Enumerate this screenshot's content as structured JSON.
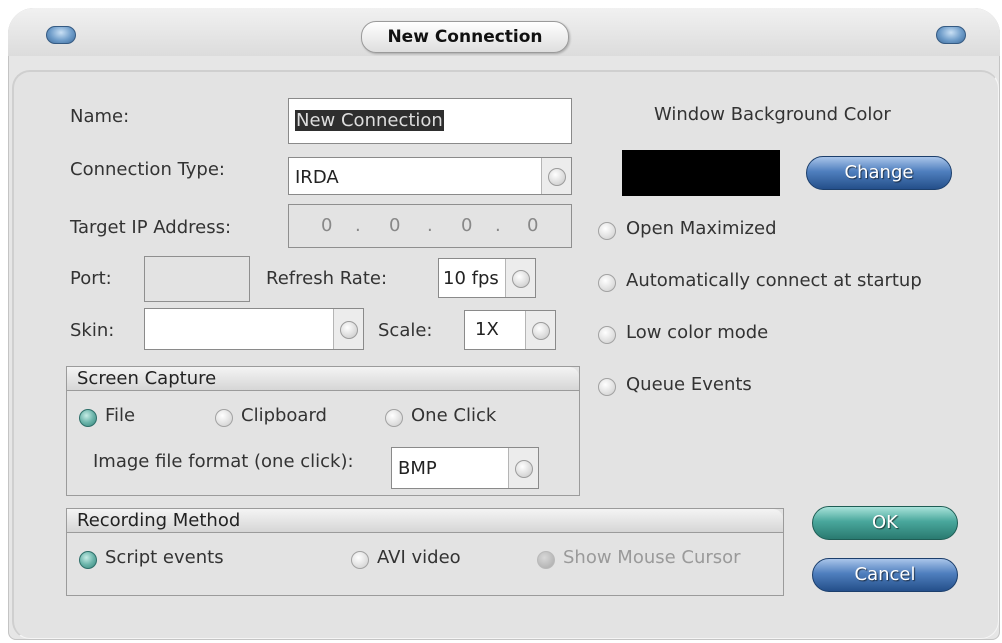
{
  "window": {
    "title": "New Connection"
  },
  "form": {
    "name_label": "Name:",
    "name_value": "New Connection",
    "connection_type_label": "Connection Type:",
    "connection_type_value": "IRDA",
    "target_ip_label": "Target IP Address:",
    "ip_octets": [
      "0",
      "0",
      "0",
      "0"
    ],
    "port_label": "Port:",
    "port_value": "",
    "refresh_rate_label": "Refresh Rate:",
    "refresh_rate_value": "10 fps",
    "skin_label": "Skin:",
    "skin_value": "",
    "scale_label": "Scale:",
    "scale_value": "1X"
  },
  "screen_capture": {
    "title": "Screen Capture",
    "options": [
      "File",
      "Clipboard",
      "One Click"
    ],
    "selected": "File",
    "format_label": "Image file format (one click):",
    "format_value": "BMP"
  },
  "recording_method": {
    "title": "Recording Method",
    "options": [
      "Script events",
      "AVI video",
      "Show Mouse Cursor"
    ],
    "selected": "Script events"
  },
  "appearance": {
    "bg_color_label": "Window Background Color",
    "bg_color": "#000000",
    "change_label": "Change"
  },
  "options": {
    "items": [
      "Open Maximized",
      "Automatically connect at startup",
      "Low color mode",
      "Queue Events"
    ]
  },
  "actions": {
    "ok_label": "OK",
    "cancel_label": "Cancel"
  },
  "colors": {
    "accent_blue": "#4f7fbe",
    "accent_teal": "#49a79c",
    "panel": "#e3e3e3"
  }
}
